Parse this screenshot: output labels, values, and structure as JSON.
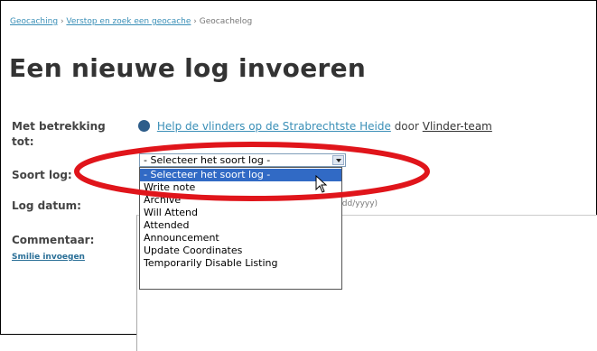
{
  "breadcrumb": {
    "home": "Geocaching",
    "sep1": "›",
    "section": "Verstop en zoek een geocache",
    "sep2": "›",
    "current": "Geocachelog"
  },
  "page_title": "Een nieuwe log invoeren",
  "form": {
    "betrekking_label": "Met betrekking tot:",
    "cache_name": "Help de vlinders op de Strabrechtste Heide",
    "door": "door",
    "owner": "Vlinder-team",
    "soort_label": "Soort log:",
    "datum_label": "Log datum:",
    "date_hint": "M/dd/yyyy)",
    "comment_label": "Commentaar:",
    "smilie_link": "Smilie invoegen"
  },
  "log_type_select": {
    "selected": "- Selecteer het soort log -",
    "options": [
      "- Selecteer het soort log -",
      "Write note",
      "Archive",
      "Will Attend",
      "Attended",
      "Announcement",
      "Update Coordinates",
      "Temporarily Disable Listing"
    ],
    "highlighted_index": 0
  },
  "annotation": {
    "color": "#e0151b",
    "shape": "ellipse"
  },
  "icons": {
    "cache": "globe-icon",
    "dropdown": "chevron-down-icon",
    "pointer": "mouse-cursor-icon"
  }
}
